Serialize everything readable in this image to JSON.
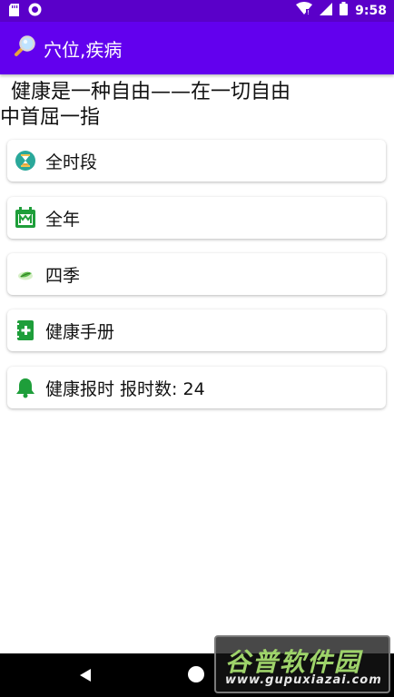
{
  "status_bar": {
    "time": "9:58",
    "icons": [
      "sd-card-icon",
      "circle-notification-icon",
      "wifi-icon",
      "signal-icon",
      "battery-icon"
    ]
  },
  "app_bar": {
    "title": "穴位,疾病",
    "icon": "magnifier-icon"
  },
  "motto": {
    "line1": "健康是一种自由——在一切自由",
    "line2": "中首屈一指"
  },
  "menu": {
    "items": [
      {
        "label": "全时段",
        "icon": "hourglass-avatar-icon"
      },
      {
        "label": "全年",
        "icon": "calendar-icon"
      },
      {
        "label": "四季",
        "icon": "leaf-icon"
      },
      {
        "label": "健康手册",
        "icon": "medical-book-icon"
      },
      {
        "label": "健康报时 报时数: 24",
        "icon": "bell-icon"
      }
    ]
  },
  "watermark": {
    "title": "谷普软件园",
    "url": "www.gupuxiazai.com"
  },
  "colors": {
    "status_bar": "#5a00c9",
    "app_bar": "#6200ee",
    "icon_green": "#1e9e3a"
  }
}
